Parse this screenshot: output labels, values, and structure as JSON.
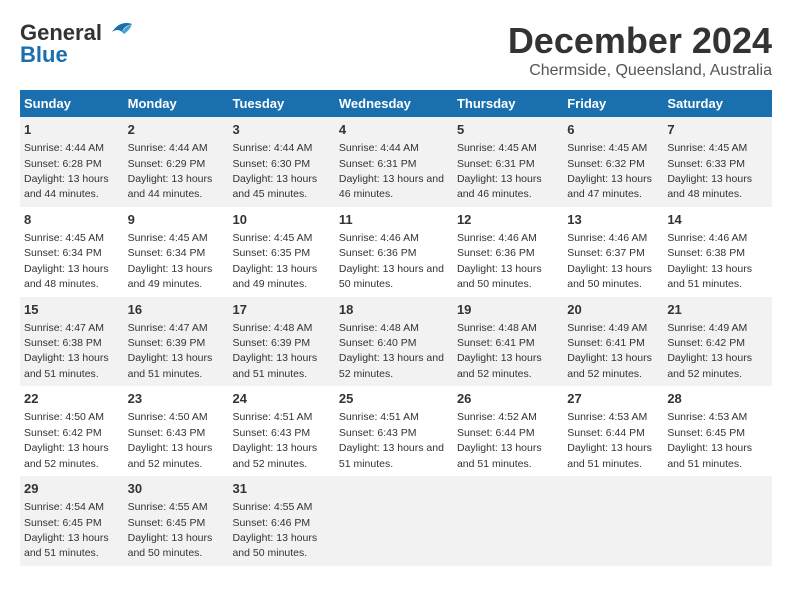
{
  "header": {
    "logo_line1": "General",
    "logo_line2": "Blue",
    "title": "December 2024",
    "subtitle": "Chermside, Queensland, Australia"
  },
  "columns": [
    "Sunday",
    "Monday",
    "Tuesday",
    "Wednesday",
    "Thursday",
    "Friday",
    "Saturday"
  ],
  "weeks": [
    [
      {
        "day": "1",
        "sunrise": "4:44 AM",
        "sunset": "6:28 PM",
        "daylight": "13 hours and 44 minutes."
      },
      {
        "day": "2",
        "sunrise": "4:44 AM",
        "sunset": "6:29 PM",
        "daylight": "13 hours and 44 minutes."
      },
      {
        "day": "3",
        "sunrise": "4:44 AM",
        "sunset": "6:30 PM",
        "daylight": "13 hours and 45 minutes."
      },
      {
        "day": "4",
        "sunrise": "4:44 AM",
        "sunset": "6:31 PM",
        "daylight": "13 hours and 46 minutes."
      },
      {
        "day": "5",
        "sunrise": "4:45 AM",
        "sunset": "6:31 PM",
        "daylight": "13 hours and 46 minutes."
      },
      {
        "day": "6",
        "sunrise": "4:45 AM",
        "sunset": "6:32 PM",
        "daylight": "13 hours and 47 minutes."
      },
      {
        "day": "7",
        "sunrise": "4:45 AM",
        "sunset": "6:33 PM",
        "daylight": "13 hours and 48 minutes."
      }
    ],
    [
      {
        "day": "8",
        "sunrise": "4:45 AM",
        "sunset": "6:34 PM",
        "daylight": "13 hours and 48 minutes."
      },
      {
        "day": "9",
        "sunrise": "4:45 AM",
        "sunset": "6:34 PM",
        "daylight": "13 hours and 49 minutes."
      },
      {
        "day": "10",
        "sunrise": "4:45 AM",
        "sunset": "6:35 PM",
        "daylight": "13 hours and 49 minutes."
      },
      {
        "day": "11",
        "sunrise": "4:46 AM",
        "sunset": "6:36 PM",
        "daylight": "13 hours and 50 minutes."
      },
      {
        "day": "12",
        "sunrise": "4:46 AM",
        "sunset": "6:36 PM",
        "daylight": "13 hours and 50 minutes."
      },
      {
        "day": "13",
        "sunrise": "4:46 AM",
        "sunset": "6:37 PM",
        "daylight": "13 hours and 50 minutes."
      },
      {
        "day": "14",
        "sunrise": "4:46 AM",
        "sunset": "6:38 PM",
        "daylight": "13 hours and 51 minutes."
      }
    ],
    [
      {
        "day": "15",
        "sunrise": "4:47 AM",
        "sunset": "6:38 PM",
        "daylight": "13 hours and 51 minutes."
      },
      {
        "day": "16",
        "sunrise": "4:47 AM",
        "sunset": "6:39 PM",
        "daylight": "13 hours and 51 minutes."
      },
      {
        "day": "17",
        "sunrise": "4:48 AM",
        "sunset": "6:39 PM",
        "daylight": "13 hours and 51 minutes."
      },
      {
        "day": "18",
        "sunrise": "4:48 AM",
        "sunset": "6:40 PM",
        "daylight": "13 hours and 52 minutes."
      },
      {
        "day": "19",
        "sunrise": "4:48 AM",
        "sunset": "6:41 PM",
        "daylight": "13 hours and 52 minutes."
      },
      {
        "day": "20",
        "sunrise": "4:49 AM",
        "sunset": "6:41 PM",
        "daylight": "13 hours and 52 minutes."
      },
      {
        "day": "21",
        "sunrise": "4:49 AM",
        "sunset": "6:42 PM",
        "daylight": "13 hours and 52 minutes."
      }
    ],
    [
      {
        "day": "22",
        "sunrise": "4:50 AM",
        "sunset": "6:42 PM",
        "daylight": "13 hours and 52 minutes."
      },
      {
        "day": "23",
        "sunrise": "4:50 AM",
        "sunset": "6:43 PM",
        "daylight": "13 hours and 52 minutes."
      },
      {
        "day": "24",
        "sunrise": "4:51 AM",
        "sunset": "6:43 PM",
        "daylight": "13 hours and 52 minutes."
      },
      {
        "day": "25",
        "sunrise": "4:51 AM",
        "sunset": "6:43 PM",
        "daylight": "13 hours and 51 minutes."
      },
      {
        "day": "26",
        "sunrise": "4:52 AM",
        "sunset": "6:44 PM",
        "daylight": "13 hours and 51 minutes."
      },
      {
        "day": "27",
        "sunrise": "4:53 AM",
        "sunset": "6:44 PM",
        "daylight": "13 hours and 51 minutes."
      },
      {
        "day": "28",
        "sunrise": "4:53 AM",
        "sunset": "6:45 PM",
        "daylight": "13 hours and 51 minutes."
      }
    ],
    [
      {
        "day": "29",
        "sunrise": "4:54 AM",
        "sunset": "6:45 PM",
        "daylight": "13 hours and 51 minutes."
      },
      {
        "day": "30",
        "sunrise": "4:55 AM",
        "sunset": "6:45 PM",
        "daylight": "13 hours and 50 minutes."
      },
      {
        "day": "31",
        "sunrise": "4:55 AM",
        "sunset": "6:46 PM",
        "daylight": "13 hours and 50 minutes."
      },
      null,
      null,
      null,
      null
    ]
  ]
}
